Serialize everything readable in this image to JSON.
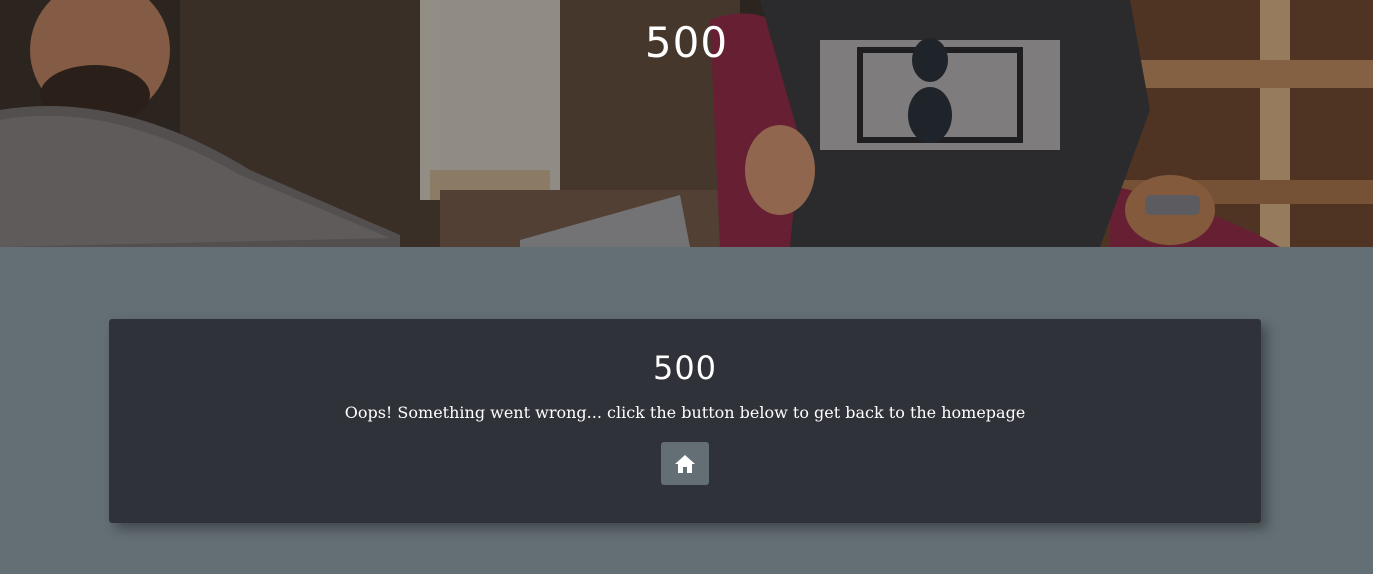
{
  "hero": {
    "title": "500"
  },
  "error_card": {
    "title": "500",
    "message": "Oops! Something went wrong... click the button below to get back to the homepage",
    "home_button_icon": "home-icon"
  },
  "colors": {
    "page_background": "#646f75",
    "card_background": "#2f3239",
    "button_background": "#646f75",
    "text": "#ffffff"
  }
}
